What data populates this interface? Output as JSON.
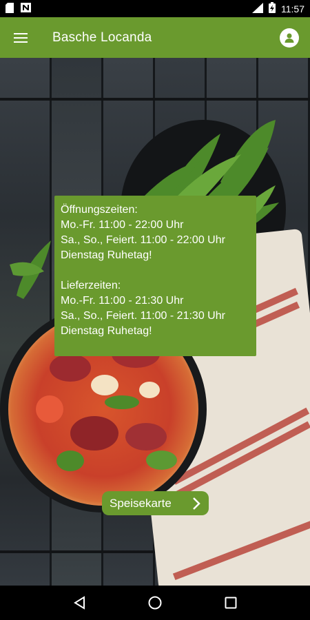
{
  "status_bar": {
    "time": "11:57",
    "icons": [
      "file-icon",
      "n-notification-icon",
      "network-lte-icon",
      "battery-charging-icon"
    ]
  },
  "app_bar": {
    "title": "Basche Locanda",
    "left_icon": "hamburger-menu-icon",
    "right_icon": "account-icon"
  },
  "info": {
    "opening_title": "Öffnungszeiten:",
    "opening_lines": [
      "Mo.-Fr. 11:00 - 22:00 Uhr",
      "Sa., So., Feiert. 11:00 - 22:00 Uhr",
      "Dienstag Ruhetag!"
    ],
    "delivery_title": "Lieferzeiten:",
    "delivery_lines": [
      "Mo.-Fr. 11:00 - 21:30 Uhr",
      "Sa., So., Feiert. 11:00 - 21:30 Uhr",
      "Dienstag Ruhetag!"
    ]
  },
  "menu_button": {
    "label": "Speisekarte",
    "icon": "chevron-right-icon"
  },
  "nav_bar": {
    "icons": [
      "back-icon",
      "home-icon",
      "recents-icon"
    ]
  },
  "colors": {
    "accent": "#6a9a2e",
    "status_bar": "#000000"
  }
}
